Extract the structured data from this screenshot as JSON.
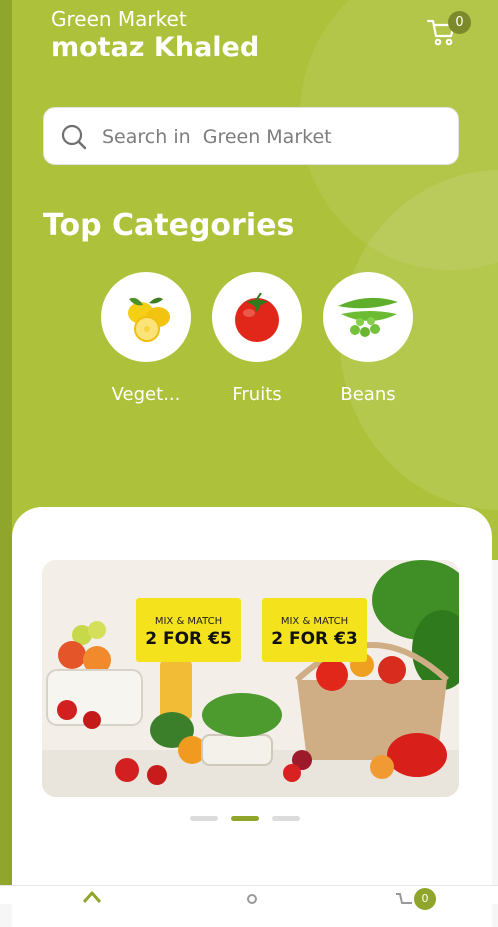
{
  "header": {
    "app_name": "Green Market",
    "user_name": "motaz Khaled",
    "cart_count": "0"
  },
  "search": {
    "placeholder": "Search in  Green Market"
  },
  "categories": {
    "title": "Top Categories",
    "items": [
      {
        "label": "Veget...",
        "icon": "lemons-icon"
      },
      {
        "label": "Fruits",
        "icon": "tomato-icon"
      },
      {
        "label": "Beans",
        "icon": "peas-icon"
      }
    ]
  },
  "banner": {
    "deal_top_1": "MIX & MATCH",
    "deal_main_1": "2 FOR €5",
    "deal_top_2": "MIX & MATCH",
    "deal_main_2": "2 FOR €3",
    "active_slide": 2,
    "slides": 3
  },
  "bottom_nav": {
    "cart_count": "0"
  },
  "colors": {
    "primary": "#adc23a",
    "dark_green": "#8fa52b",
    "deal_yellow": "#f4e21c"
  }
}
